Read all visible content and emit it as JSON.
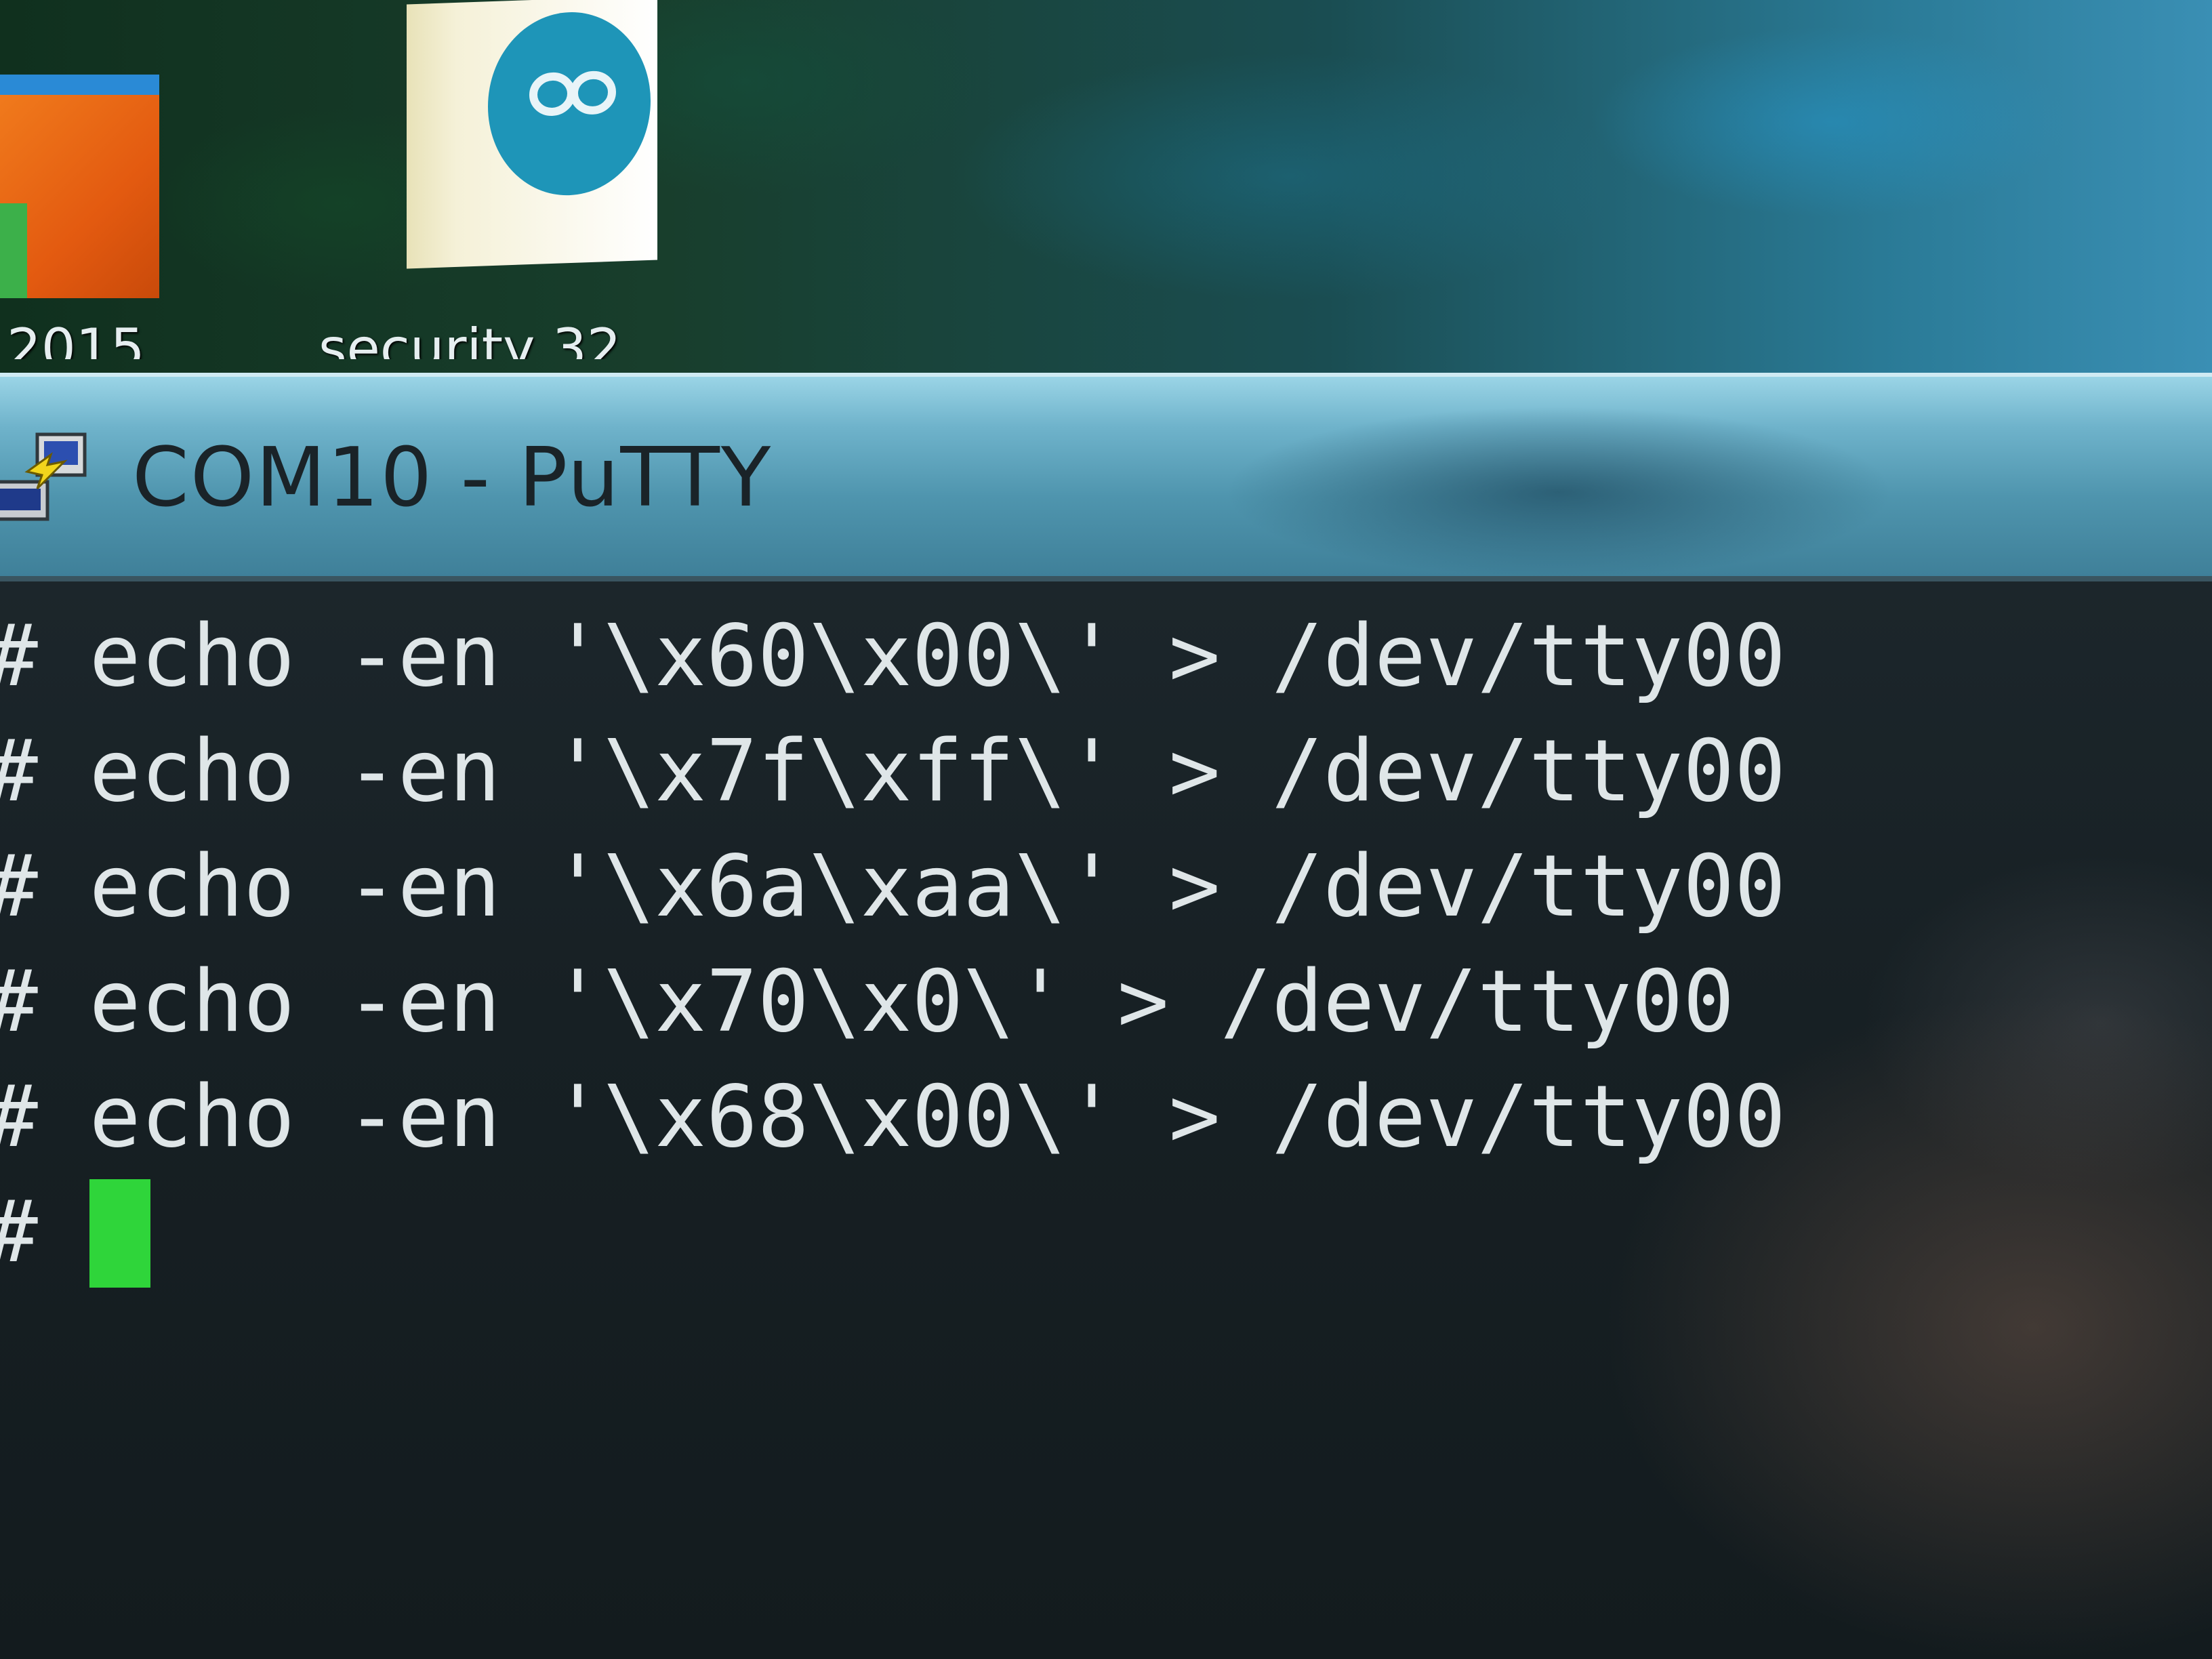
{
  "desktop": {
    "icons": [
      {
        "label": "2015",
        "icon": "orange-app-icon"
      },
      {
        "label": "security 32",
        "icon": "arduino-icon"
      }
    ]
  },
  "window": {
    "title": "COM10 - PuTTY",
    "icon": "putty-icon"
  },
  "terminal": {
    "prompt": "#",
    "lines": [
      {
        "prompt": "#",
        "command": "echo -en '\\x60\\x00\\' > /dev/tty00"
      },
      {
        "prompt": "#",
        "command": "echo -en '\\x7f\\xff\\' > /dev/tty00"
      },
      {
        "prompt": "#",
        "command": "echo -en '\\x6a\\xaa\\' > /dev/tty00"
      },
      {
        "prompt": "#",
        "command": "echo -en '\\x70\\x0\\' > /dev/tty00"
      },
      {
        "prompt": "#",
        "command": "echo -en '\\x68\\x00\\' > /dev/tty00"
      }
    ],
    "current_prompt": "#",
    "cursor_color": "#2fd53a",
    "text_color": "#dfe6e8",
    "background_color": "#172024"
  }
}
